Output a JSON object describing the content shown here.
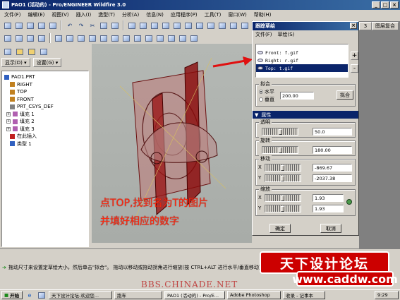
{
  "window": {
    "title": "PAO1 (活动的) - Pro/ENGINEER Wildfire 3.0"
  },
  "menu": [
    "文件(F)",
    "编辑(E)",
    "视图(V)",
    "插入(I)",
    "造型(T)",
    "分析(A)",
    "信息(N)",
    "应用程序(P)",
    "工具(T)",
    "窗口(W)",
    "帮助(H)"
  ],
  "right_tabs": {
    "tab1": "3",
    "tab2": "图层复合"
  },
  "left_tabs": {
    "display": "显示(D) ▾",
    "settings": "设置(G) ▾"
  },
  "tree": [
    {
      "label": "PAO1.PRT",
      "icon": "part-icon",
      "color": "#3060c0"
    },
    {
      "label": "RIGHT",
      "icon": "datum-plane-icon",
      "color": "#c08020"
    },
    {
      "label": "TOP",
      "icon": "datum-plane-icon",
      "color": "#c08020"
    },
    {
      "label": "FRONT",
      "icon": "datum-plane-icon",
      "color": "#c08020"
    },
    {
      "label": "PRT_CSYS_DEF",
      "icon": "csys-icon",
      "color": "#808080"
    },
    {
      "label": "填充 1",
      "icon": "fill-icon",
      "color": "#b060b0"
    },
    {
      "label": "填充 2",
      "icon": "fill-icon",
      "color": "#b060b0"
    },
    {
      "label": "填充 3",
      "icon": "fill-icon",
      "color": "#b060b0"
    },
    {
      "label": "在此插入",
      "icon": "insert-here-icon",
      "color": "#c02020"
    },
    {
      "label": "类型 1",
      "icon": "style-icon",
      "color": "#3060c0"
    }
  ],
  "dialog": {
    "title": "跟踪草绘",
    "menu": [
      "文件(F)",
      "草绘(S)"
    ],
    "images": [
      {
        "label": "Front: f.gif",
        "selected": false
      },
      {
        "label": "Right: r.gif",
        "selected": false
      },
      {
        "label": "Top: t.gif",
        "selected": true
      }
    ],
    "add_label": "+",
    "remove_label": "-",
    "fit": {
      "group_label": "拟合",
      "horizontal": "水平",
      "vertical": "垂直",
      "value": "200.00",
      "button": "拟合"
    },
    "properties_header": "属性",
    "transparency": {
      "label": "透明",
      "value": "50.0",
      "level": 0.5
    },
    "rotation": {
      "label": "旋转",
      "value": "180.00",
      "level": 0.5
    },
    "move": {
      "label": "移动",
      "x_label": "X",
      "y_label": "Y",
      "x_value": "-869.67",
      "y_value": "-2037.38"
    },
    "scale": {
      "label": "缩放",
      "x_label": "X",
      "y_label": "Y",
      "x_value": "1.93",
      "y_value": "1.93"
    },
    "ok": "确定",
    "cancel": "取消"
  },
  "annotation": {
    "line1": "点TOP,找到名为T的图片",
    "line2": "并填好相应的数字"
  },
  "status": "拖动尺寸来设置定草绘大小，然后单击\"拟合\"。 拖动以移动或拖动拐角进行缩放(按 CTRL+ALT 进行水平/垂直移动)。移动鼠标",
  "brand": {
    "name": "天下设计论坛",
    "url": "www.caddw.com",
    "watermark": "BBS.CHINADE.NET"
  },
  "taskbar": {
    "start": "开始",
    "items": [
      "天下设计论坛-欢迎您...",
      "跑车",
      "PAO1 (活动的) - Pro/E...",
      "Adobe Photoshop",
      "收录 - 记事本"
    ],
    "clock": "9:29"
  },
  "colors": {
    "title_blue": "#0a246a",
    "accent_red": "#ff2a10"
  }
}
